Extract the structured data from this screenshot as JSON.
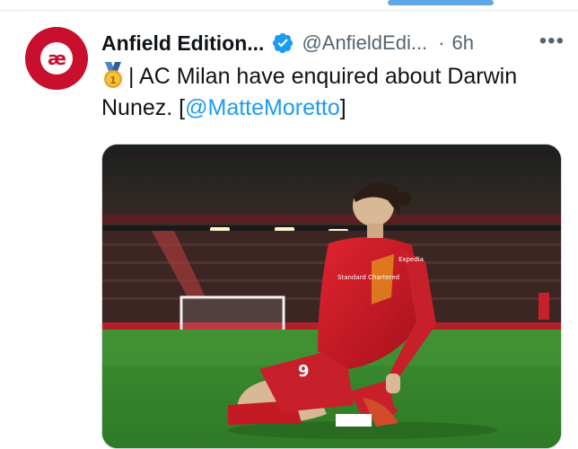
{
  "post": {
    "author_name": "Anfield Edition...",
    "handle": "@AnfieldEdi...",
    "separator": "·",
    "time": "6h",
    "more_icon": "more-icon",
    "avatar_text": "æ",
    "text_main": "| AC Milan have enquired about Darwin Nunez. [",
    "mention": "@MatteMoretto",
    "text_end": "]",
    "shirt_number": "9",
    "sponsor": "Standard Chartered",
    "sleeve": "Expedia"
  },
  "colors": {
    "accent": "#1d9bf0",
    "brand_red": "#c8102e",
    "pitch_green": "#3f8f32"
  }
}
